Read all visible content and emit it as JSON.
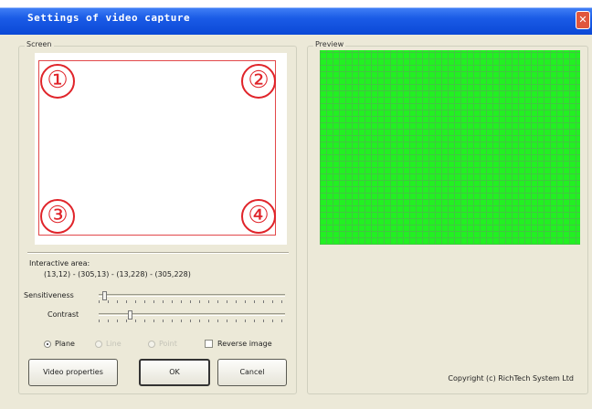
{
  "window": {
    "title": "Settings of video capture",
    "close_glyph": "✕"
  },
  "groups": {
    "left_label": "Screen",
    "right_label": "Preview"
  },
  "corners": [
    "①",
    "②",
    "③",
    "④"
  ],
  "interactive_area": {
    "label": "Interactive area:",
    "value": "(13,12) - (305,13) - (13,228) - (305,228)"
  },
  "sliders": [
    {
      "label": "Sensitiveness",
      "value": 0.02
    },
    {
      "label": "Contrast",
      "value": 0.16
    }
  ],
  "options": {
    "plane": {
      "label": "Plane",
      "checked": true
    },
    "opt2": {
      "label": "Line",
      "disabled": true
    },
    "opt3": {
      "label": "Point",
      "disabled": true
    },
    "reverse": {
      "label": "Reverse image",
      "checked": false
    }
  },
  "buttons": {
    "video_properties": "Video properties",
    "ok": "OK",
    "cancel": "Cancel"
  },
  "copyright": "Copyright (c) RichTech System Ltd",
  "colors": {
    "preview_green": "#22f022",
    "title_blue": "#0b49d6",
    "marker_red": "#e0242a"
  }
}
